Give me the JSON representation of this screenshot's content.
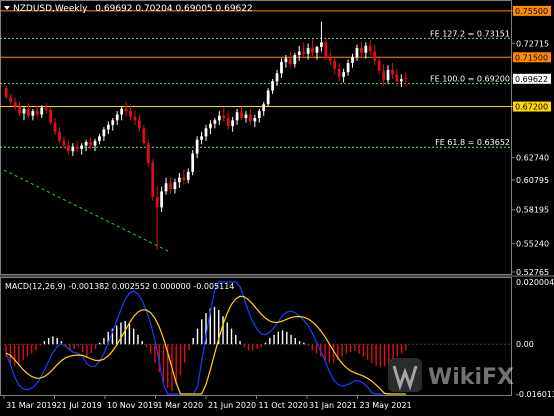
{
  "header": {
    "symbol": "NZDUSD,Weekly",
    "ohlc": "0.69692 0.70204 0.69005 0.69622"
  },
  "colors": {
    "background": "#000000",
    "bull_candle": "#ffffff",
    "bear_candle": "#e01010",
    "resistance_line": "#ff8c00",
    "support_line": "#ffd700",
    "fib_line": "#7fdc7f",
    "trend_line": "#32cd32",
    "macd_histogram_positive": "#ffffff",
    "macd_histogram_negative": "#e01010",
    "macd_line": "#1e3cff",
    "signal_line": "#ffd700"
  },
  "price_axis": {
    "ticks": [
      "0.75550",
      "0.72715",
      "0.69622",
      "0.67200",
      "0.62740",
      "0.60795",
      "0.58195",
      "0.55240",
      "0.52765"
    ]
  },
  "price_levels": [
    {
      "price": 0.7555,
      "label": "0.75500",
      "tag_bg": "#ff8c00",
      "tag_fg": "#000000",
      "line": "#ff8c00",
      "style": "solid"
    },
    {
      "price": 0.715,
      "label": "0.71500",
      "tag_bg": "#ff8c00",
      "tag_fg": "#000000",
      "line": "#ff8c00",
      "style": "solid"
    },
    {
      "price": 0.69622,
      "label": "0.69622",
      "tag_bg": "#ffffff",
      "tag_fg": "#000000",
      "line": null,
      "style": "none"
    },
    {
      "price": 0.672,
      "label": "0.67200",
      "tag_bg": "#ffd700",
      "tag_fg": "#000000",
      "line": "#ffd700",
      "style": "solid"
    }
  ],
  "fib_levels": [
    {
      "price": 0.73151,
      "label": "FE 127.2 = 0.73151"
    },
    {
      "price": 0.692,
      "label": "FE 100.0 = 0.69200"
    },
    {
      "price": 0.63652,
      "label": "FE 61.8 = 0.63652"
    }
  ],
  "macd": {
    "label": "MACD(12,26,9) -0.001382 0.002552 0.000000 -0.005114",
    "ticks": [
      "0.020004",
      "0.00",
      "-0.016013"
    ],
    "histogram": [
      -0.004,
      -0.006,
      -0.007,
      -0.0065,
      -0.005,
      -0.004,
      -0.003,
      -0.002,
      -0.0005,
      0.001,
      0.002,
      0.0025,
      0.002,
      0.001,
      -0.001,
      -0.002,
      -0.0015,
      -0.001,
      -0.0025,
      -0.004,
      -0.003,
      -0.0015,
      0.0005,
      0.002,
      0.004,
      0.005,
      0.006,
      0.007,
      0.0075,
      0.0065,
      0.005,
      0.003,
      0.001,
      -0.001,
      -0.003,
      -0.006,
      -0.009,
      -0.012,
      -0.014,
      -0.015,
      -0.013,
      -0.01,
      -0.006,
      -0.002,
      0.002,
      0.005,
      0.008,
      0.01,
      0.0115,
      0.012,
      0.011,
      0.009,
      0.007,
      0.005,
      0.003,
      0.001,
      -0.001,
      -0.002,
      -0.002,
      -0.0015,
      -0.001,
      0.0005,
      0.002,
      0.003,
      0.004,
      0.0045,
      0.004,
      0.003,
      0.002,
      0.001,
      0.0005,
      -0.0005,
      -0.002,
      -0.003,
      -0.004,
      -0.005,
      -0.006,
      -0.006,
      -0.005,
      -0.004,
      -0.003,
      -0.0025,
      -0.002,
      -0.003,
      -0.004,
      -0.005,
      -0.006,
      -0.007,
      -0.0075,
      -0.007,
      -0.006,
      -0.005,
      -0.004,
      -0.003,
      -0.002
    ]
  },
  "date_axis": {
    "ticks": [
      "31 Mar 2019",
      "21 Jul 2019",
      "10 Nov 2019",
      "1 Mar 2020",
      "21 Jun 2020",
      "11 Oct 2020",
      "31 Jan 2021",
      "23 May 2021"
    ]
  },
  "watermark": "WikiFX",
  "chart_data": {
    "type": "candlestick",
    "symbol": "NZDUSD",
    "timeframe": "Weekly",
    "ylim": [
      0.5276,
      0.7615
    ],
    "ohlc": [
      [
        0.688,
        0.69,
        0.679,
        0.68
      ],
      [
        0.68,
        0.683,
        0.673,
        0.676
      ],
      [
        0.676,
        0.68,
        0.669,
        0.672
      ],
      [
        0.672,
        0.676,
        0.664,
        0.666
      ],
      [
        0.666,
        0.672,
        0.66,
        0.67
      ],
      [
        0.67,
        0.675,
        0.662,
        0.664
      ],
      [
        0.664,
        0.67,
        0.66,
        0.668
      ],
      [
        0.668,
        0.673,
        0.663,
        0.665
      ],
      [
        0.665,
        0.673,
        0.662,
        0.671
      ],
      [
        0.671,
        0.675,
        0.666,
        0.669
      ],
      [
        0.669,
        0.672,
        0.656,
        0.658
      ],
      [
        0.658,
        0.662,
        0.647,
        0.65
      ],
      [
        0.65,
        0.654,
        0.64,
        0.642
      ],
      [
        0.642,
        0.646,
        0.636,
        0.638
      ],
      [
        0.638,
        0.642,
        0.63,
        0.633
      ],
      [
        0.633,
        0.64,
        0.629,
        0.637
      ],
      [
        0.637,
        0.642,
        0.632,
        0.635
      ],
      [
        0.635,
        0.64,
        0.63,
        0.638
      ],
      [
        0.638,
        0.643,
        0.633,
        0.641
      ],
      [
        0.641,
        0.645,
        0.635,
        0.638
      ],
      [
        0.638,
        0.644,
        0.633,
        0.642
      ],
      [
        0.642,
        0.648,
        0.639,
        0.646
      ],
      [
        0.646,
        0.654,
        0.642,
        0.652
      ],
      [
        0.652,
        0.659,
        0.648,
        0.656
      ],
      [
        0.656,
        0.662,
        0.651,
        0.66
      ],
      [
        0.66,
        0.668,
        0.656,
        0.665
      ],
      [
        0.665,
        0.672,
        0.66,
        0.67
      ],
      [
        0.67,
        0.676,
        0.664,
        0.668
      ],
      [
        0.668,
        0.673,
        0.66,
        0.663
      ],
      [
        0.663,
        0.668,
        0.656,
        0.66
      ],
      [
        0.66,
        0.665,
        0.65,
        0.653
      ],
      [
        0.653,
        0.656,
        0.638,
        0.64
      ],
      [
        0.64,
        0.643,
        0.62,
        0.623
      ],
      [
        0.623,
        0.626,
        0.59,
        0.593
      ],
      [
        0.593,
        0.602,
        0.547,
        0.584
      ],
      [
        0.584,
        0.602,
        0.58,
        0.598
      ],
      [
        0.598,
        0.61,
        0.595,
        0.605
      ],
      [
        0.605,
        0.61,
        0.596,
        0.6
      ],
      [
        0.6,
        0.609,
        0.596,
        0.606
      ],
      [
        0.606,
        0.614,
        0.601,
        0.61
      ],
      [
        0.61,
        0.617,
        0.604,
        0.608
      ],
      [
        0.608,
        0.618,
        0.605,
        0.615
      ],
      [
        0.615,
        0.634,
        0.612,
        0.631
      ],
      [
        0.631,
        0.646,
        0.627,
        0.643
      ],
      [
        0.643,
        0.65,
        0.639,
        0.646
      ],
      [
        0.646,
        0.656,
        0.642,
        0.653
      ],
      [
        0.653,
        0.66,
        0.648,
        0.657
      ],
      [
        0.657,
        0.662,
        0.653,
        0.66
      ],
      [
        0.66,
        0.668,
        0.656,
        0.664
      ],
      [
        0.664,
        0.671,
        0.659,
        0.662
      ],
      [
        0.662,
        0.668,
        0.652,
        0.655
      ],
      [
        0.655,
        0.663,
        0.65,
        0.66
      ],
      [
        0.66,
        0.67,
        0.656,
        0.667
      ],
      [
        0.667,
        0.672,
        0.66,
        0.662
      ],
      [
        0.662,
        0.668,
        0.658,
        0.665
      ],
      [
        0.665,
        0.67,
        0.656,
        0.659
      ],
      [
        0.659,
        0.665,
        0.654,
        0.662
      ],
      [
        0.662,
        0.67,
        0.658,
        0.668
      ],
      [
        0.668,
        0.676,
        0.664,
        0.674
      ],
      [
        0.674,
        0.688,
        0.672,
        0.686
      ],
      [
        0.686,
        0.696,
        0.683,
        0.694
      ],
      [
        0.694,
        0.704,
        0.69,
        0.701
      ],
      [
        0.701,
        0.714,
        0.697,
        0.711
      ],
      [
        0.711,
        0.717,
        0.706,
        0.714
      ],
      [
        0.714,
        0.72,
        0.706,
        0.709
      ],
      [
        0.709,
        0.719,
        0.706,
        0.717
      ],
      [
        0.717,
        0.725,
        0.712,
        0.72
      ],
      [
        0.72,
        0.728,
        0.715,
        0.718
      ],
      [
        0.718,
        0.727,
        0.713,
        0.723
      ],
      [
        0.723,
        0.731,
        0.716,
        0.719
      ],
      [
        0.719,
        0.725,
        0.713,
        0.724
      ],
      [
        0.724,
        0.746,
        0.72,
        0.728
      ],
      [
        0.728,
        0.732,
        0.712,
        0.715
      ],
      [
        0.715,
        0.72,
        0.708,
        0.712
      ],
      [
        0.712,
        0.716,
        0.7,
        0.705
      ],
      [
        0.705,
        0.71,
        0.694,
        0.698
      ],
      [
        0.698,
        0.705,
        0.693,
        0.702
      ],
      [
        0.702,
        0.713,
        0.699,
        0.71
      ],
      [
        0.71,
        0.718,
        0.706,
        0.715
      ],
      [
        0.715,
        0.726,
        0.712,
        0.723
      ],
      [
        0.723,
        0.729,
        0.715,
        0.719
      ],
      [
        0.719,
        0.728,
        0.714,
        0.725
      ],
      [
        0.725,
        0.73,
        0.717,
        0.72
      ],
      [
        0.72,
        0.726,
        0.708,
        0.712
      ],
      [
        0.712,
        0.716,
        0.7,
        0.703
      ],
      [
        0.703,
        0.709,
        0.69,
        0.695
      ],
      [
        0.695,
        0.708,
        0.692,
        0.704
      ],
      [
        0.704,
        0.71,
        0.696,
        0.7
      ],
      [
        0.7,
        0.705,
        0.69,
        0.694
      ],
      [
        0.694,
        0.7,
        0.689,
        0.696
      ],
      [
        0.6969,
        0.702,
        0.6901,
        0.6962
      ]
    ]
  }
}
